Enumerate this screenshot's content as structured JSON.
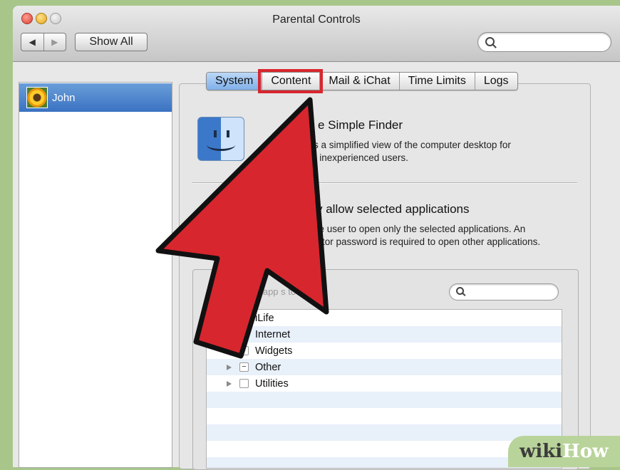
{
  "window": {
    "title": "Parental Controls"
  },
  "toolbar": {
    "back_icon": "chevron-left-icon",
    "forward_icon": "chevron-right-icon",
    "show_all_label": "Show All",
    "search_value": ""
  },
  "sidebar": {
    "users": [
      {
        "name": "John",
        "selected": true
      }
    ]
  },
  "tabs": [
    {
      "label": "System",
      "selected": true
    },
    {
      "label": "Content",
      "selected": false,
      "highlighted": true
    },
    {
      "label": "Mail & iChat",
      "selected": false
    },
    {
      "label": "Time Limits",
      "selected": false
    },
    {
      "label": "Logs",
      "selected": false
    }
  ],
  "system": {
    "simple_finder": {
      "title_visible": "e Simple Finder",
      "desc_line1": "s a simplified view of the computer desktop for",
      "desc_line2": "r inexperienced users."
    },
    "only_allow": {
      "title_visible": "y allow selected applications",
      "desc_line1": "he user to open only the selected applications. An",
      "desc_line2": "rator password is required to open other applications."
    },
    "app_filter": {
      "hint_visible": "e app      s to allow",
      "search_value": ""
    },
    "apps": [
      {
        "label": "iLife",
        "checked": null
      },
      {
        "label": "Internet",
        "checked": true
      },
      {
        "label": "Widgets",
        "checked": true
      },
      {
        "label": "Other",
        "checked": "mixed"
      },
      {
        "label": "Utilities",
        "checked": false
      }
    ]
  },
  "overlay": {
    "arrow_color": "#d8262e",
    "highlight_color": "#d8262e"
  },
  "watermark": {
    "part1": "wiki",
    "part2": "How"
  }
}
